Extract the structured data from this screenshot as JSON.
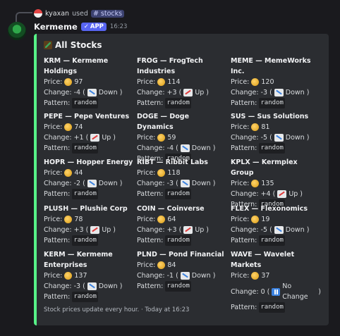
{
  "reply": {
    "user": "kyaxan",
    "action": "used",
    "command": "# stocks"
  },
  "message": {
    "username": "Kermeme",
    "badge": "APP",
    "time": "16:23"
  },
  "embed": {
    "title": "All Stocks",
    "footer": "Stock prices update every hour. · Today at 16:23",
    "accent_color": "#57f287",
    "labels": {
      "price": "Price:",
      "change": "Change:",
      "pattern": "Pattern:"
    },
    "stocks": [
      {
        "name": "KRM — Kermeme Holdings",
        "price": "97",
        "change": "-4",
        "dir": "Down",
        "trend": "down",
        "pattern": "random"
      },
      {
        "name": "FROG — FrogTech Industries",
        "price": "114",
        "change": "+3",
        "dir": "Up",
        "trend": "up",
        "pattern": "random"
      },
      {
        "name": "MEME — MemeWorks Inc.",
        "price": "120",
        "change": "-3",
        "dir": "Down",
        "trend": "down",
        "pattern": "random"
      },
      {
        "name": "PEPE — Pepe Ventures",
        "price": "74",
        "change": "+1",
        "dir": "Up",
        "trend": "up",
        "pattern": "random"
      },
      {
        "name": "DOGE — Doge Dynamics",
        "price": "59",
        "change": "-4",
        "dir": "Down",
        "trend": "down",
        "pattern": "random"
      },
      {
        "name": "SUS — Sus Solutions",
        "price": "81",
        "change": "-5",
        "dir": "Down",
        "trend": "down",
        "pattern": "random"
      },
      {
        "name": "HOPR — Hopper Energy",
        "price": "44",
        "change": "-2",
        "dir": "Down",
        "trend": "down",
        "pattern": "random"
      },
      {
        "name": "RIBT — Ribbit Labs",
        "price": "118",
        "change": "-3",
        "dir": "Down",
        "trend": "down",
        "pattern": "random"
      },
      {
        "name": "KPLX — Kermplex Group",
        "price": "135",
        "change": "+4",
        "dir": "Up",
        "trend": "up",
        "pattern": "random"
      },
      {
        "name": "PLUSH — Plushie Corp",
        "price": "78",
        "change": "+3",
        "dir": "Up",
        "trend": "up",
        "pattern": "random"
      },
      {
        "name": "COIN — Coinverse",
        "price": "64",
        "change": "+3",
        "dir": "Up",
        "trend": "up",
        "pattern": "random"
      },
      {
        "name": "FLEX — Flexonomics",
        "price": "19",
        "change": "-5",
        "dir": "Down",
        "trend": "down",
        "pattern": "random"
      },
      {
        "name": "KERM — Kermeme Enterprises",
        "price": "137",
        "change": "-3",
        "dir": "Down",
        "trend": "down",
        "pattern": "random"
      },
      {
        "name": "PLND — Pond Financial",
        "price": "84",
        "change": "-1",
        "dir": "Down",
        "trend": "down",
        "pattern": "random"
      },
      {
        "name": "WAVE — Wavelet Markets",
        "price": "37",
        "change": "0",
        "dir": "No Change",
        "trend": "flat",
        "pattern": "random"
      }
    ]
  }
}
